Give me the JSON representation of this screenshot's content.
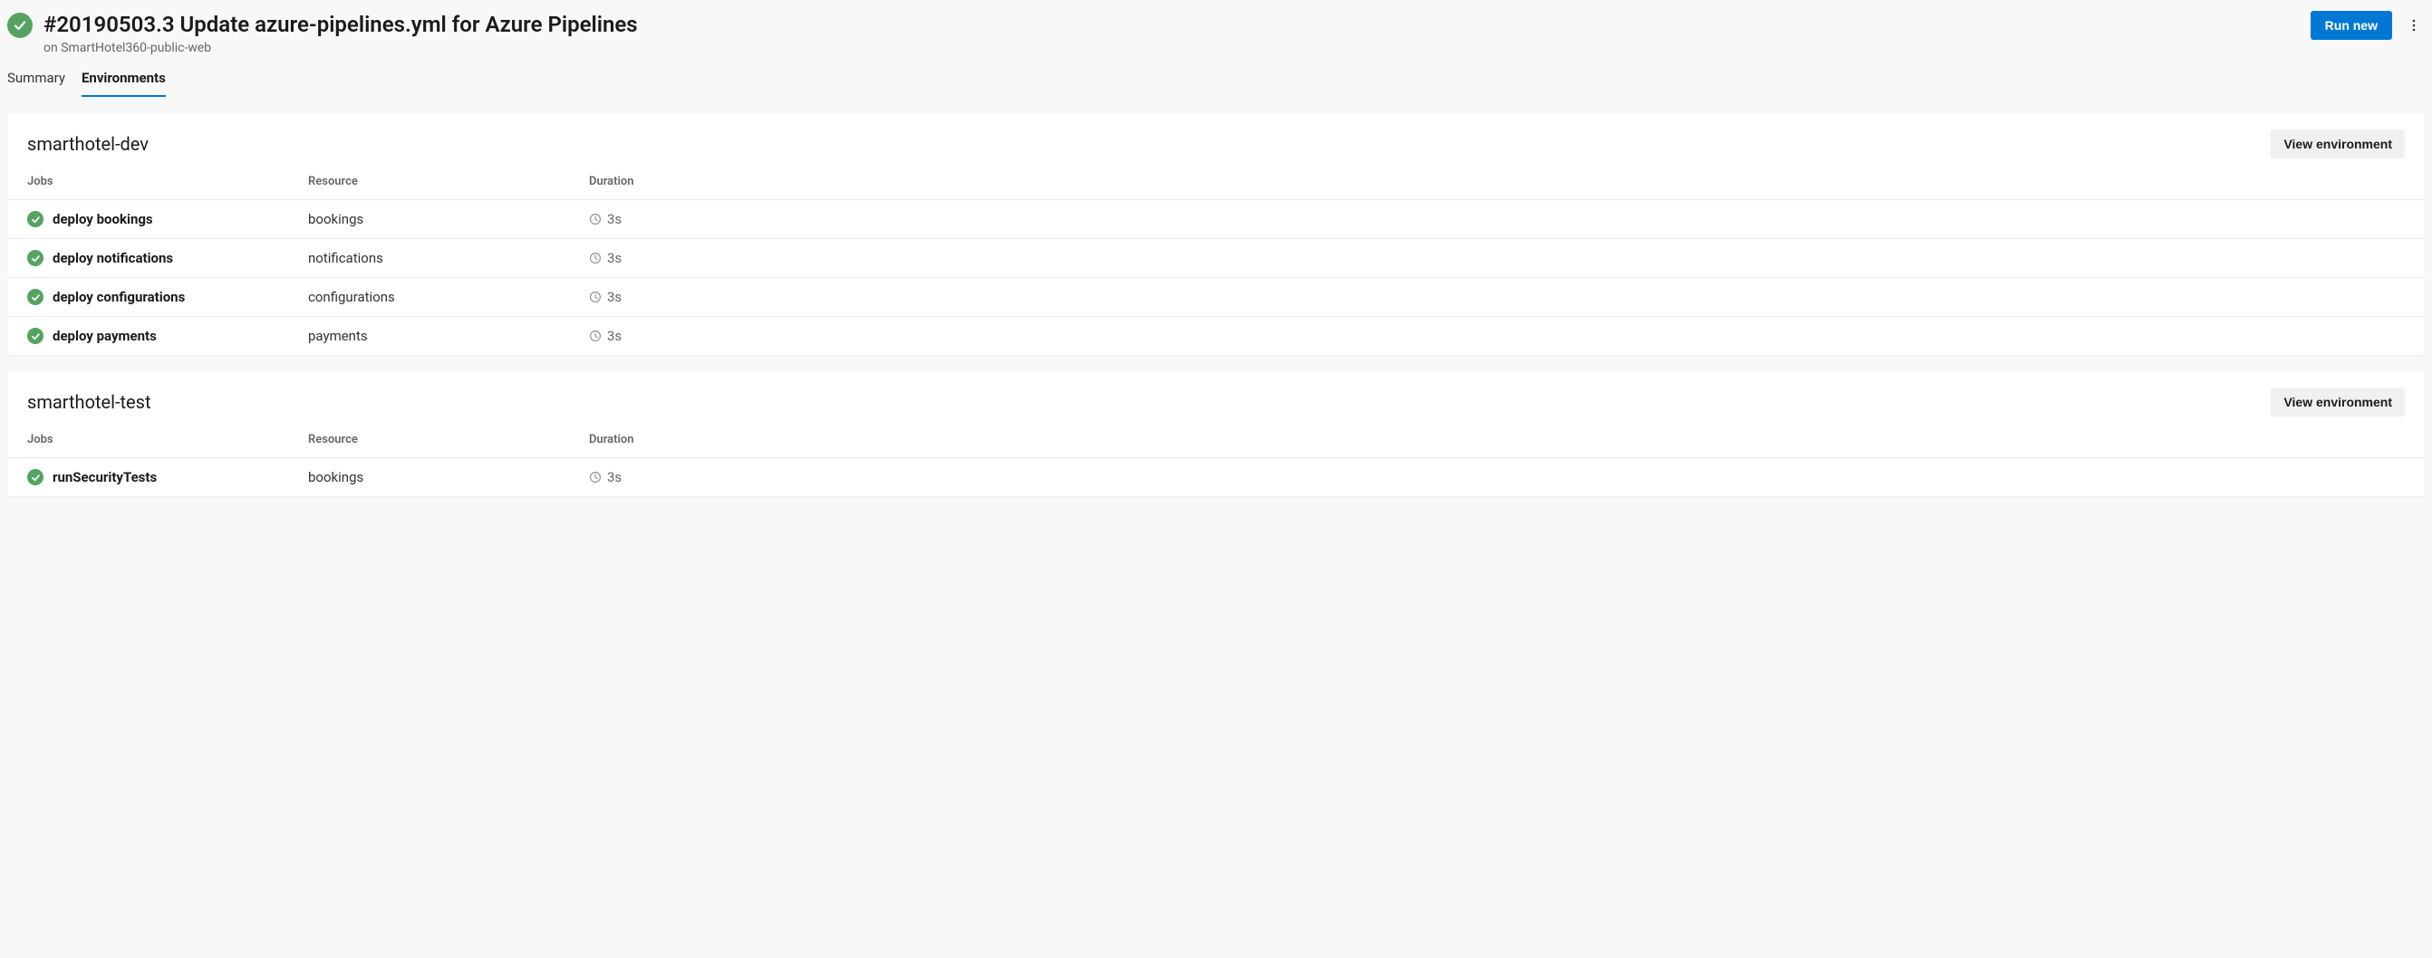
{
  "header": {
    "title": "#20190503.3 Update azure-pipelines.yml for Azure Pipelines",
    "subtitle": "on SmartHotel360-public-web",
    "run_new_label": "Run new"
  },
  "tabs": {
    "summary": "Summary",
    "environments": "Environments"
  },
  "columns": {
    "jobs": "Jobs",
    "resource": "Resource",
    "duration": "Duration"
  },
  "view_env_label": "View environment",
  "environments": [
    {
      "name": "smarthotel-dev",
      "jobs": [
        {
          "name": "deploy bookings",
          "resource": "bookings",
          "duration": "3s"
        },
        {
          "name": "deploy notifications",
          "resource": "notifications",
          "duration": "3s"
        },
        {
          "name": "deploy configurations",
          "resource": "configurations",
          "duration": "3s"
        },
        {
          "name": "deploy payments",
          "resource": "payments",
          "duration": "3s"
        }
      ]
    },
    {
      "name": "smarthotel-test",
      "jobs": [
        {
          "name": "runSecurityTests",
          "resource": "bookings",
          "duration": "3s"
        }
      ]
    }
  ]
}
